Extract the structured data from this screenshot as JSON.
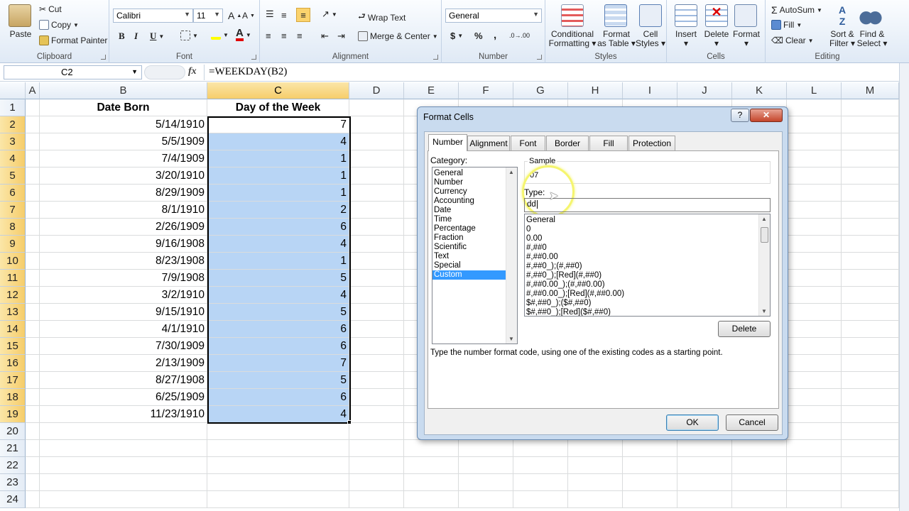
{
  "ribbon": {
    "clipboard": {
      "label": "Clipboard",
      "paste": "Paste",
      "cut": "Cut",
      "copy": "Copy",
      "format_painter": "Format Painter"
    },
    "font": {
      "label": "Font",
      "name": "Calibri",
      "size": "11",
      "bold": "B",
      "italic": "I",
      "underline": "U",
      "font_color": "A"
    },
    "alignment": {
      "label": "Alignment",
      "wrap_text": "Wrap Text",
      "merge_center": "Merge & Center"
    },
    "number": {
      "label": "Number",
      "format": "General",
      "currency": "$",
      "percent": "%",
      "comma": ","
    },
    "styles": {
      "label": "Styles",
      "conditional": "Conditional",
      "conditional2": "Formatting",
      "format_table": "Format",
      "format_table2": "as Table",
      "cell_styles": "Cell",
      "cell_styles2": "Styles"
    },
    "cells": {
      "label": "Cells",
      "insert": "Insert",
      "delete": "Delete",
      "format": "Format"
    },
    "editing": {
      "label": "Editing",
      "autosum": "AutoSum",
      "fill": "Fill",
      "clear": "Clear",
      "sort": "Sort &",
      "sort2": "Filter",
      "find": "Find &",
      "find2": "Select"
    }
  },
  "formula_bar": {
    "name_box": "C2",
    "fx": "fx",
    "formula": "=WEEKDAY(B2)"
  },
  "columns": [
    "A",
    "B",
    "C",
    "D",
    "E",
    "F",
    "G",
    "H",
    "I",
    "J",
    "K",
    "L",
    "M"
  ],
  "rows": [
    {
      "num": "1",
      "b": "Date Born",
      "c": "Day of the Week"
    },
    {
      "num": "2",
      "b": "5/14/1910",
      "c": "7"
    },
    {
      "num": "3",
      "b": "5/5/1909",
      "c": "4"
    },
    {
      "num": "4",
      "b": "7/4/1909",
      "c": "1"
    },
    {
      "num": "5",
      "b": "3/20/1910",
      "c": "1"
    },
    {
      "num": "6",
      "b": "8/29/1909",
      "c": "1"
    },
    {
      "num": "7",
      "b": "8/1/1910",
      "c": "2"
    },
    {
      "num": "8",
      "b": "2/26/1909",
      "c": "6"
    },
    {
      "num": "9",
      "b": "9/16/1908",
      "c": "4"
    },
    {
      "num": "10",
      "b": "8/23/1908",
      "c": "1"
    },
    {
      "num": "11",
      "b": "7/9/1908",
      "c": "5"
    },
    {
      "num": "12",
      "b": "3/2/1910",
      "c": "4"
    },
    {
      "num": "13",
      "b": "9/15/1910",
      "c": "5"
    },
    {
      "num": "14",
      "b": "4/1/1910",
      "c": "6"
    },
    {
      "num": "15",
      "b": "7/30/1909",
      "c": "6"
    },
    {
      "num": "16",
      "b": "2/13/1909",
      "c": "7"
    },
    {
      "num": "17",
      "b": "8/27/1908",
      "c": "5"
    },
    {
      "num": "18",
      "b": "6/25/1909",
      "c": "6"
    },
    {
      "num": "19",
      "b": "11/23/1910",
      "c": "4"
    },
    {
      "num": "20",
      "b": "",
      "c": ""
    },
    {
      "num": "21",
      "b": "",
      "c": ""
    },
    {
      "num": "22",
      "b": "",
      "c": ""
    },
    {
      "num": "23",
      "b": "",
      "c": ""
    },
    {
      "num": "24",
      "b": "",
      "c": ""
    }
  ],
  "dialog": {
    "title": "Format Cells",
    "help": "?",
    "close": "✕",
    "tabs": [
      "Number",
      "Alignment",
      "Font",
      "Border",
      "Fill",
      "Protection"
    ],
    "category_label": "Category:",
    "categories": [
      "General",
      "Number",
      "Currency",
      "Accounting",
      "Date",
      "Time",
      "Percentage",
      "Fraction",
      "Scientific",
      "Text",
      "Special",
      "Custom"
    ],
    "selected_category": "Custom",
    "sample_label": "Sample",
    "sample_value": "07",
    "type_label": "Type:",
    "type_value": "dd",
    "formats": [
      "General",
      "0",
      "0.00",
      "#,##0",
      "#,##0.00",
      "#,##0_);(#,##0)",
      "#,##0_);[Red](#,##0)",
      "#,##0.00_);(#,##0.00)",
      "#,##0.00_);[Red](#,##0.00)",
      "$#,##0_);($#,##0)",
      "$#,##0_);[Red]($#,##0)"
    ],
    "delete_label": "Delete",
    "hint": "Type the number format code, using one of the existing codes as a starting point.",
    "ok_label": "OK",
    "cancel_label": "Cancel"
  },
  "colors": {
    "selection": "#b8d5f5",
    "header_selected": "#f6cd6a",
    "list_selected": "#3399ff",
    "cursor_highlight": "#f5f56e"
  }
}
